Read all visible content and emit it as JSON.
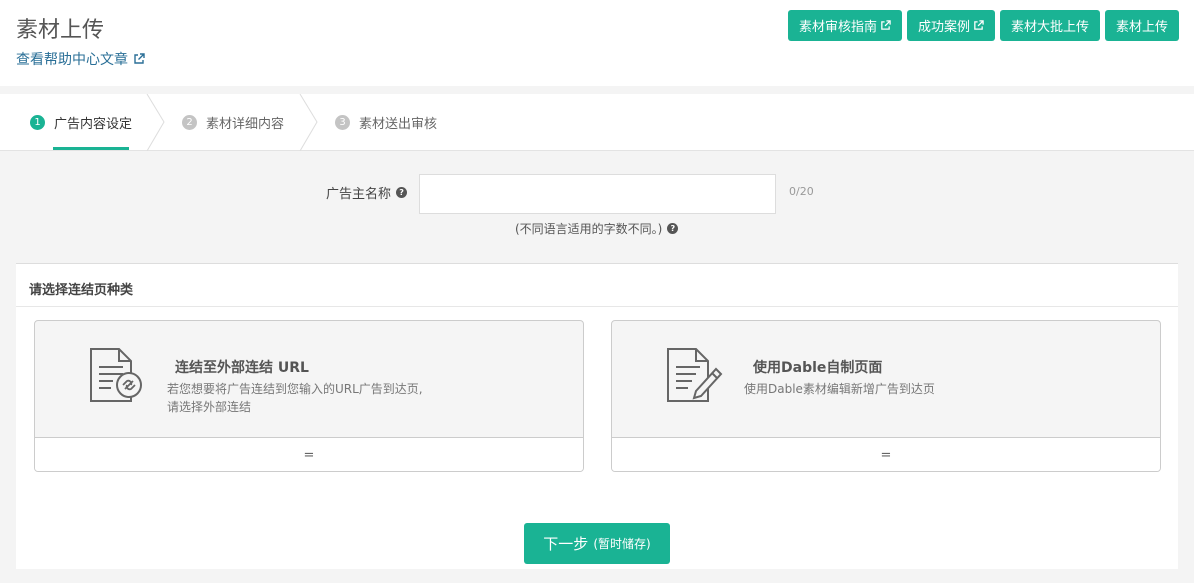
{
  "header": {
    "title": "素材上传",
    "help_link": "查看帮助中心文章",
    "buttons": [
      {
        "label": "素材审核指南",
        "external": true
      },
      {
        "label": "成功案例",
        "external": true
      },
      {
        "label": "素材大批上传",
        "external": false
      },
      {
        "label": "素材上传",
        "external": false
      }
    ]
  },
  "steps": [
    {
      "num": "1",
      "label": "广告内容设定",
      "active": true
    },
    {
      "num": "2",
      "label": "素材详细内容",
      "active": false
    },
    {
      "num": "3",
      "label": "素材送出审核",
      "active": false
    }
  ],
  "form": {
    "advertiser_label": "广告主名称",
    "advertiser_value": "",
    "advertiser_placeholder": "",
    "counter": "0/20",
    "hint": "(不同语言适用的字数不同。)"
  },
  "link_type": {
    "title": "请选择连结页种类",
    "options": [
      {
        "title": "连结至外部连结 URL",
        "desc_line1": "若您想要将广告连结到您输入的URL广告到达页,",
        "desc_line2": "请选择外部连结",
        "footer": "="
      },
      {
        "title": "使用Dable自制页面",
        "desc_line1": "使用Dable素材编辑新增广告到达页",
        "desc_line2": "",
        "footer": "="
      }
    ]
  },
  "next_button": {
    "label": "下一步",
    "sub_label": "(暂时储存)"
  },
  "colors": {
    "accent": "#1ab394",
    "link": "#2a6f97"
  },
  "icons": [
    "external-link-icon",
    "question-circle-icon",
    "document-link-icon",
    "document-edit-icon"
  ]
}
